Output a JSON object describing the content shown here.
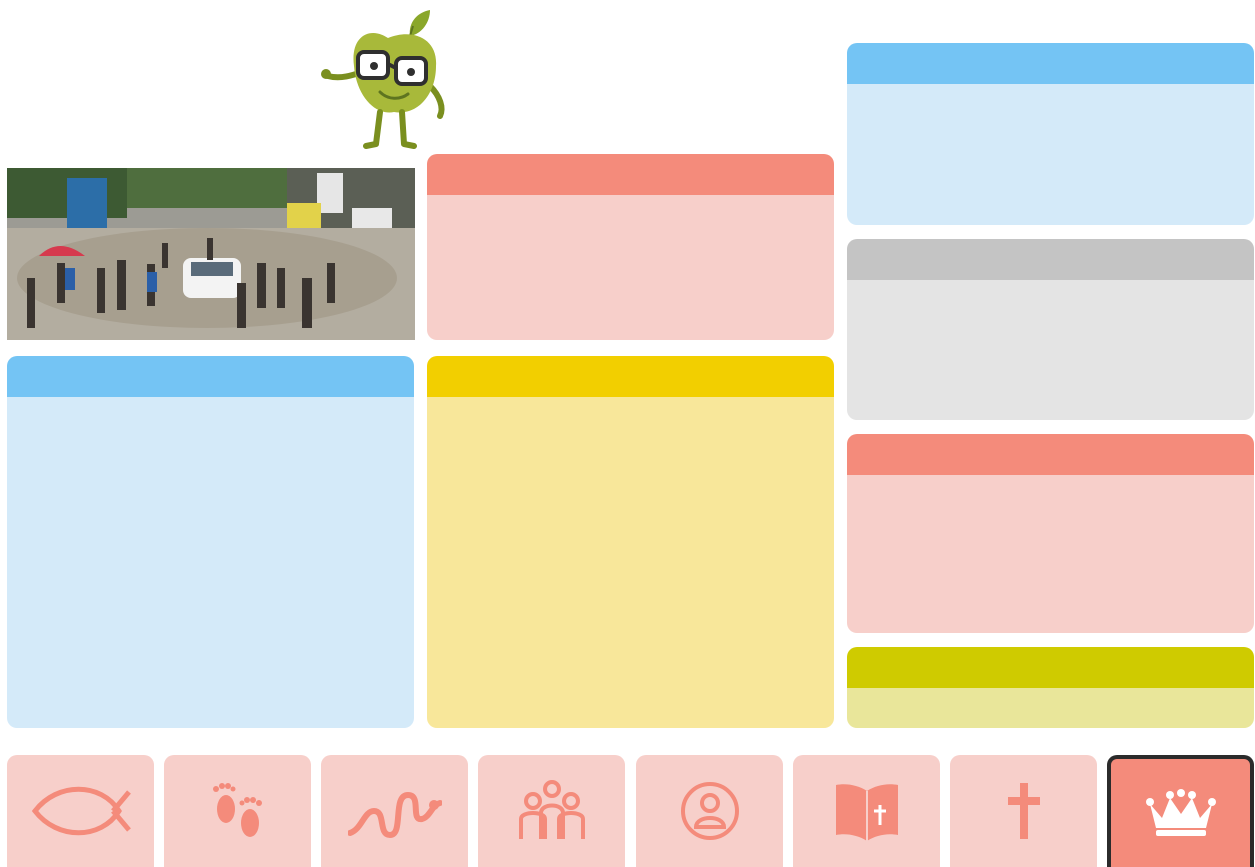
{
  "colors": {
    "blue_header": "#74c4f4",
    "blue_body": "#d4eaf9",
    "salmon_header": "#f48b7b",
    "salmon_body": "#f7cfca",
    "yellow_header": "#f2cf00",
    "yellow_body": "#f8e79a",
    "gray_header": "#c4c4c4",
    "gray_body": "#e4e4e4",
    "olive_header": "#cfcb00",
    "olive_body": "#e9e69a",
    "nav_tile": "#f7cfca",
    "nav_icon": "#f48b7b",
    "nav_active": "#f48b7b"
  },
  "mascot": {
    "icon": "apple-mascot-icon"
  },
  "photo": {
    "icon": "flooded-street-photo"
  },
  "panels": [
    {
      "id": "panel-photo-caption",
      "color": "salmon"
    },
    {
      "id": "panel-left-large",
      "color": "blue"
    },
    {
      "id": "panel-center-large",
      "color": "yellow"
    },
    {
      "id": "panel-right-top",
      "color": "blue"
    },
    {
      "id": "panel-right-gray",
      "color": "gray"
    },
    {
      "id": "panel-right-salmon",
      "color": "salmon"
    },
    {
      "id": "panel-right-bottom",
      "color": "olive"
    }
  ],
  "nav": {
    "items": [
      {
        "icon": "fish-icon",
        "active": false
      },
      {
        "icon": "footprints-icon",
        "active": false
      },
      {
        "icon": "serpent-icon",
        "active": false
      },
      {
        "icon": "family-icon",
        "active": false
      },
      {
        "icon": "person-circle-icon",
        "active": false
      },
      {
        "icon": "bible-icon",
        "active": false
      },
      {
        "icon": "cross-icon",
        "active": false
      },
      {
        "icon": "crown-icon",
        "active": true
      }
    ]
  }
}
